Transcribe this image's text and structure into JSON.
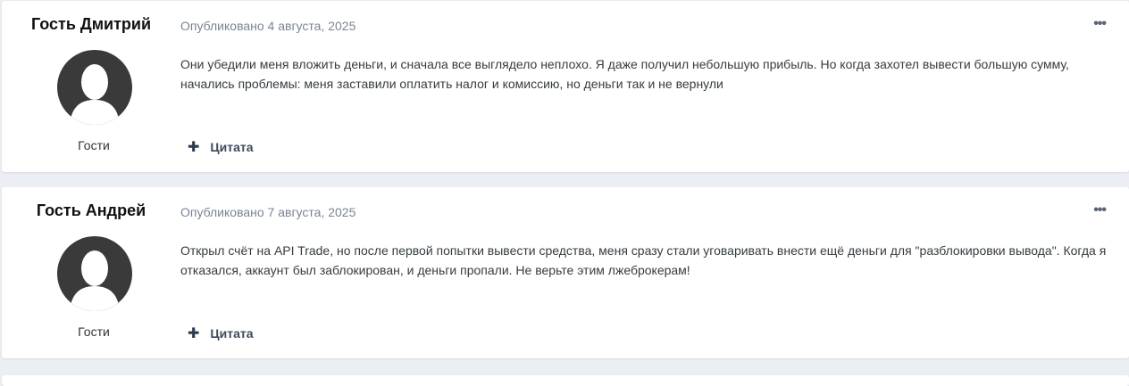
{
  "posts": [
    {
      "author": "Гость Дмитрий",
      "group": "Гости",
      "published": "Опубликовано 4 августа, 2025",
      "text": "Они убедили меня вложить деньги, и сначала все выглядело неплохо. Я даже получил небольшую прибыль. Но когда захотел вывести большую сумму, начались проблемы: меня заставили оплатить налог и комиссию, но деньги так и не вернули",
      "quote_label": "Цитата",
      "menu_glyph": "•••"
    },
    {
      "author": "Гость Андрей",
      "group": "Гости",
      "published": "Опубликовано 7 августа, 2025",
      "text": "Открыл счёт на API Trade, но после первой попытки вывести средства, меня сразу стали уговаривать внести ещё деньги для \"разблокировки вывода\". Когда я отказался, аккаунт был заблокирован, и деньги пропали. Не верьте этим лжеброкерам!",
      "quote_label": "Цитата",
      "menu_glyph": "•••"
    }
  ],
  "icons": {
    "quote": "plus-icon",
    "avatar": "default-user-avatar",
    "menu": "more-options-icon"
  },
  "colors": {
    "background": "#ebeef2",
    "card": "#ffffff",
    "meta_text": "#7a8494",
    "avatar": "#3a3a3a"
  }
}
